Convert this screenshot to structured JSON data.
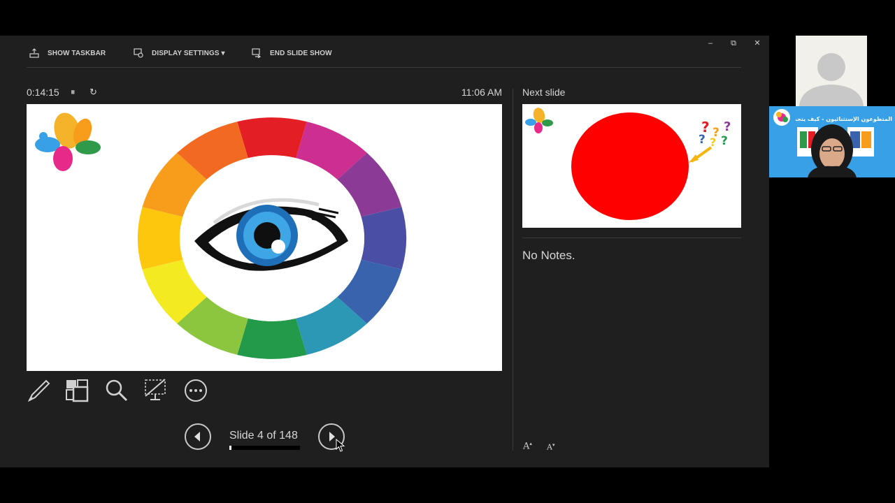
{
  "toolbar": {
    "show_taskbar": "SHOW TASKBAR",
    "display_settings": "DISPLAY SETTINGS ▾",
    "end_show": "END SLIDE SHOW"
  },
  "window_controls": {
    "minimize": "–",
    "restore": "⧉",
    "close": "✕"
  },
  "timer": {
    "elapsed": "0:14:15",
    "pause_icon": "pause-icon",
    "reset_icon": "restart-icon",
    "pause": "⏸",
    "reset": "↻"
  },
  "clock": "11:06 AM",
  "nav": {
    "slide_label": "Slide 4 of 148",
    "current": 4,
    "total": 148
  },
  "next_slide": {
    "label": "Next slide"
  },
  "notes": {
    "text": "No Notes."
  },
  "font_controls": {
    "increase": "A",
    "decrease": "A"
  },
  "tools": [
    "pen-icon",
    "see-all-slides-icon",
    "zoom-icon",
    "black-screen-icon",
    "more-options-icon"
  ],
  "video": {
    "banner_text": "المتطوعون الإستثنائيون - كيف يتجمعون ؟"
  },
  "colors": {
    "wheel": [
      "#e31e24",
      "#cc2f8f",
      "#8b3a96",
      "#4a4fa5",
      "#3964ad",
      "#2d98b6",
      "#229a4a",
      "#8cc63f",
      "#f3ea21",
      "#fdc70e",
      "#f89c1c",
      "#f26a22"
    ],
    "background": "#1f1f1f",
    "next_circle": "#ff0000"
  }
}
